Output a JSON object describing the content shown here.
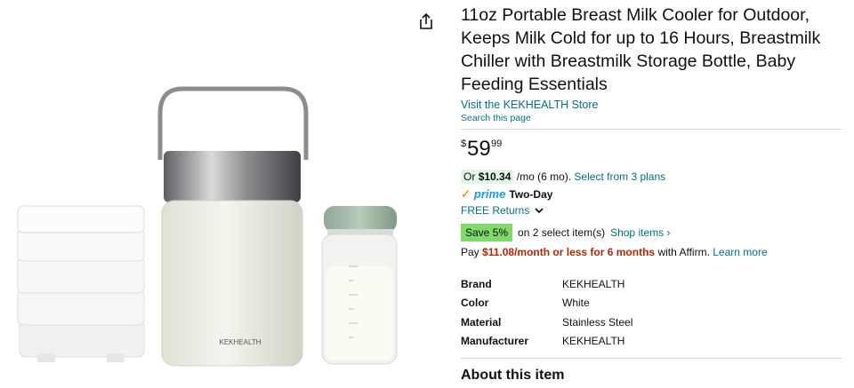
{
  "product": {
    "title": "11oz Portable Breast Milk Cooler for Outdoor, Keeps Milk Cold for up to 16 Hours, Breastmilk Chiller with Breastmilk Storage Bottle, Baby Feeding Essentials",
    "store_link": "Visit the KEKHEALTH Store",
    "search_page_link": "Search this page",
    "brand_on_product": "KEKHEALTH"
  },
  "price": {
    "symbol": "$",
    "whole": "59",
    "fraction": "99"
  },
  "plan": {
    "or": "Or",
    "amount": "$10.34",
    "suffix": "/mo (6 mo).",
    "link": "Select from 3 plans"
  },
  "prime": {
    "check": "✓",
    "logo": "prime",
    "delivery": "Two-Day",
    "returns": "FREE Returns"
  },
  "coupon": {
    "badge": "Save 5%",
    "text": "on 2 select item(s)",
    "link": "Shop items ›"
  },
  "affirm": {
    "pre": "Pay",
    "amount": "$11.08/month or less for 6 months",
    "post": "with Affirm.",
    "link": "Learn more"
  },
  "specs": [
    {
      "key": "Brand",
      "value": "KEKHEALTH"
    },
    {
      "key": "Color",
      "value": "White"
    },
    {
      "key": "Material",
      "value": "Stainless Steel"
    },
    {
      "key": "Manufacturer",
      "value": "KEKHEALTH"
    }
  ],
  "about_heading": "About this item",
  "icons": {
    "share": "share-icon",
    "chevron": "chevron-down-icon"
  },
  "colors": {
    "link": "#007185",
    "price_red": "#b12704",
    "coupon_green": "#7fda69",
    "prime_blue": "#1a98ff"
  }
}
